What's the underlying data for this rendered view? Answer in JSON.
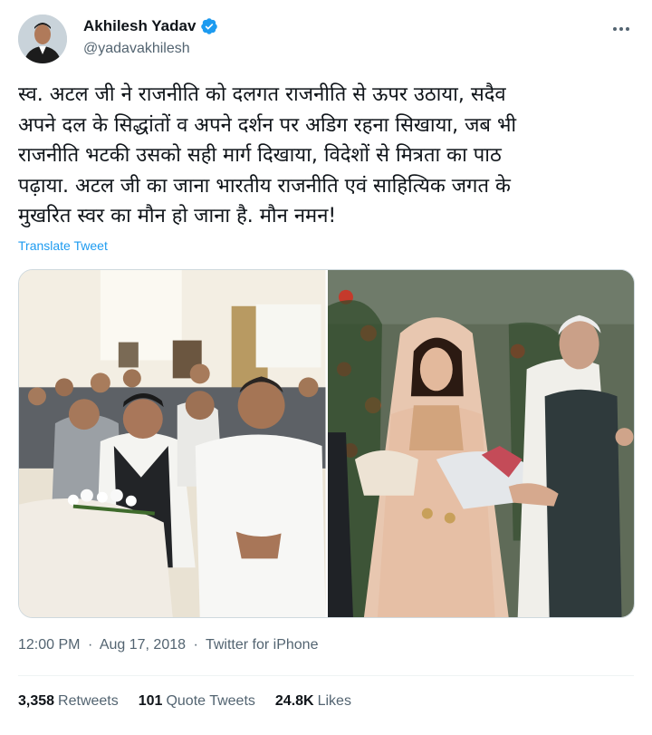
{
  "author": {
    "display_name": "Akhilesh Yadav",
    "handle": "@yadavakhilesh",
    "verified": true,
    "avatar_icon": "profile-photo"
  },
  "tweet": {
    "text": "स्व. अटल जी ने राजनीति को दलगत राजनीति से ऊपर उठाया, सदैव\nअपने दल के सिद्धांतों व अपने दर्शन पर अडिग रहना सिखाया, जब भी\nराजनीति भटकी उसको सही मार्ग दिखाया, विदेशों से मित्रता का पाठ\nपढ़ाया. अटल जी का जाना भारतीय राजनीति एवं साहित्यिक जगत के\nमुखरित स्वर का मौन हो जाना है. मौन नमन!",
    "translate_label": "Translate Tweet"
  },
  "media": {
    "photos": [
      "photo-1",
      "photo-2"
    ]
  },
  "meta": {
    "time": "12:00 PM",
    "date": "Aug 17, 2018",
    "source": "Twitter for iPhone",
    "separator": "·"
  },
  "stats": {
    "retweets_count": "3,358",
    "retweets_label": "Retweets",
    "quotes_count": "101",
    "quotes_label": "Quote Tweets",
    "likes_count": "24.8K",
    "likes_label": "Likes"
  },
  "colors": {
    "accent": "#1d9bf0",
    "secondary_text": "#536471",
    "border": "#cfd9de"
  }
}
